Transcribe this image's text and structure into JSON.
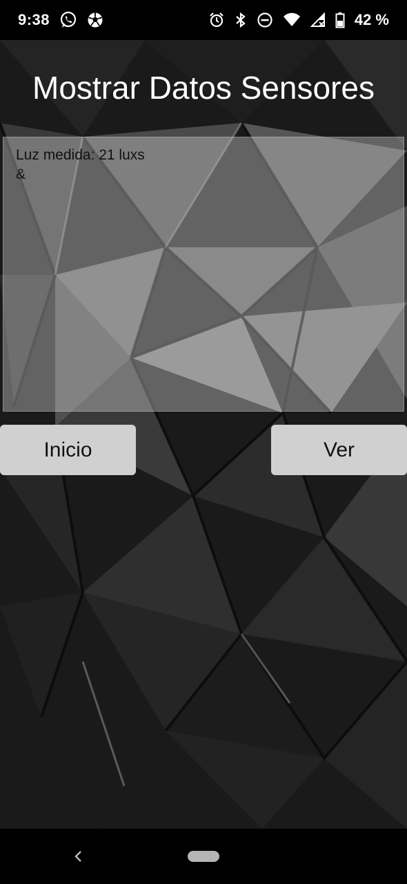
{
  "status_bar": {
    "time": "9:38",
    "left_icons": [
      "whatsapp-icon",
      "soccer-ball-icon"
    ],
    "right_icons": [
      "alarm-icon",
      "bluetooth-icon",
      "do-not-disturb-icon",
      "wifi-icon",
      "signal-icon",
      "battery-icon"
    ],
    "battery_percent": "42 %"
  },
  "header": {
    "title": "Mostrar Datos Sensores"
  },
  "sensor_panel": {
    "text": "Luz medida: 21 luxs\n&"
  },
  "buttons": {
    "inicio_label": "Inicio",
    "ver_label": "Ver"
  },
  "navigation": {
    "back_icon": "chevron-left-icon",
    "home_icon": "home-pill-icon"
  },
  "colors": {
    "background": "#151515",
    "button_bg": "#d0d0d0",
    "panel_overlay": "rgba(200,200,200,0.42)",
    "text_light": "#ffffff"
  }
}
